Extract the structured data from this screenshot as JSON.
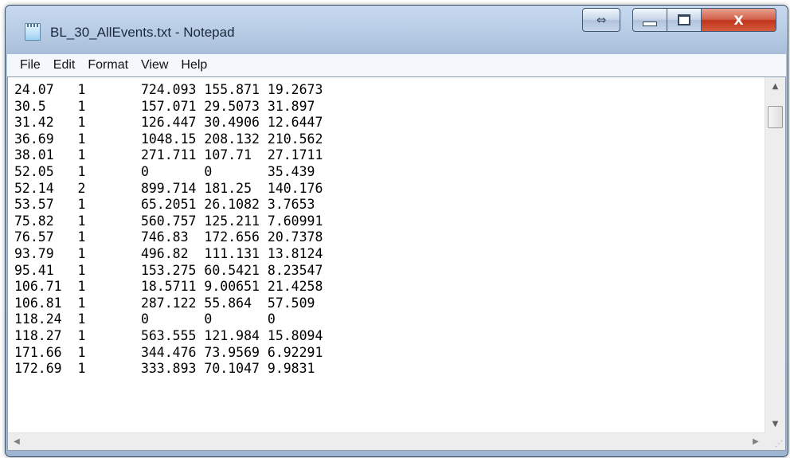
{
  "window": {
    "title": "BL_30_AllEvents.txt - Notepad",
    "icon": "notepad-icon",
    "buttons": {
      "snap": "⇔",
      "minimize": "",
      "maximize": "",
      "close": "X"
    }
  },
  "menu": {
    "items": [
      "File",
      "Edit",
      "Format",
      "View",
      "Help"
    ]
  },
  "document": {
    "lines": [
      "24.07   1       724.093 155.871 19.2673",
      "30.5    1       157.071 29.5073 31.897",
      "31.42   1       126.447 30.4906 12.6447",
      "36.69   1       1048.15 208.132 210.562",
      "38.01   1       271.711 107.71  27.1711",
      "52.05   1       0       0       35.439",
      "52.14   2       899.714 181.25  140.176",
      "53.57   1       65.2051 26.1082 3.7653",
      "75.82   1       560.757 125.211 7.60991",
      "76.57   1       746.83  172.656 20.7378",
      "93.79   1       496.82  111.131 13.8124",
      "95.41   1       153.275 60.5421 8.23547",
      "106.71  1       18.5711 9.00651 21.4258",
      "106.81  1       287.122 55.864  57.509",
      "118.24  1       0       0       0",
      "118.27  1       563.555 121.984 15.8094",
      "171.66  1       344.476 73.9569 6.92291",
      "172.69  1       333.893 70.1047 9.9831"
    ]
  },
  "scrollbars": {
    "up": "▲",
    "down": "▼",
    "left": "◀",
    "right": "▶",
    "grip": "⋰"
  }
}
